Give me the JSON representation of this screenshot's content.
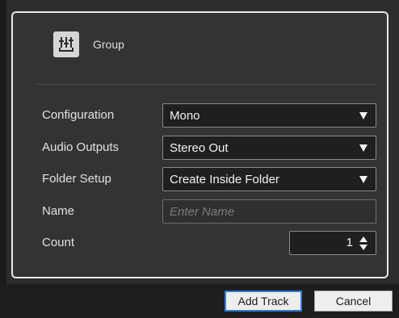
{
  "dialog": {
    "track_type": {
      "label": "Group",
      "icon": "group-track-icon"
    },
    "fields": {
      "configuration": {
        "label": "Configuration",
        "value": "Mono"
      },
      "audio_outputs": {
        "label": "Audio Outputs",
        "value": "Stereo Out"
      },
      "folder_setup": {
        "label": "Folder Setup",
        "value": "Create Inside Folder"
      },
      "name": {
        "label": "Name",
        "value": "",
        "placeholder": "Enter Name"
      },
      "count": {
        "label": "Count",
        "value": "1"
      }
    },
    "buttons": {
      "add_track": "Add Track",
      "cancel": "Cancel"
    },
    "colors": {
      "accent": "#2f7fd6",
      "panel_border": "#e8e8e8",
      "background": "#2d2d2d"
    }
  }
}
